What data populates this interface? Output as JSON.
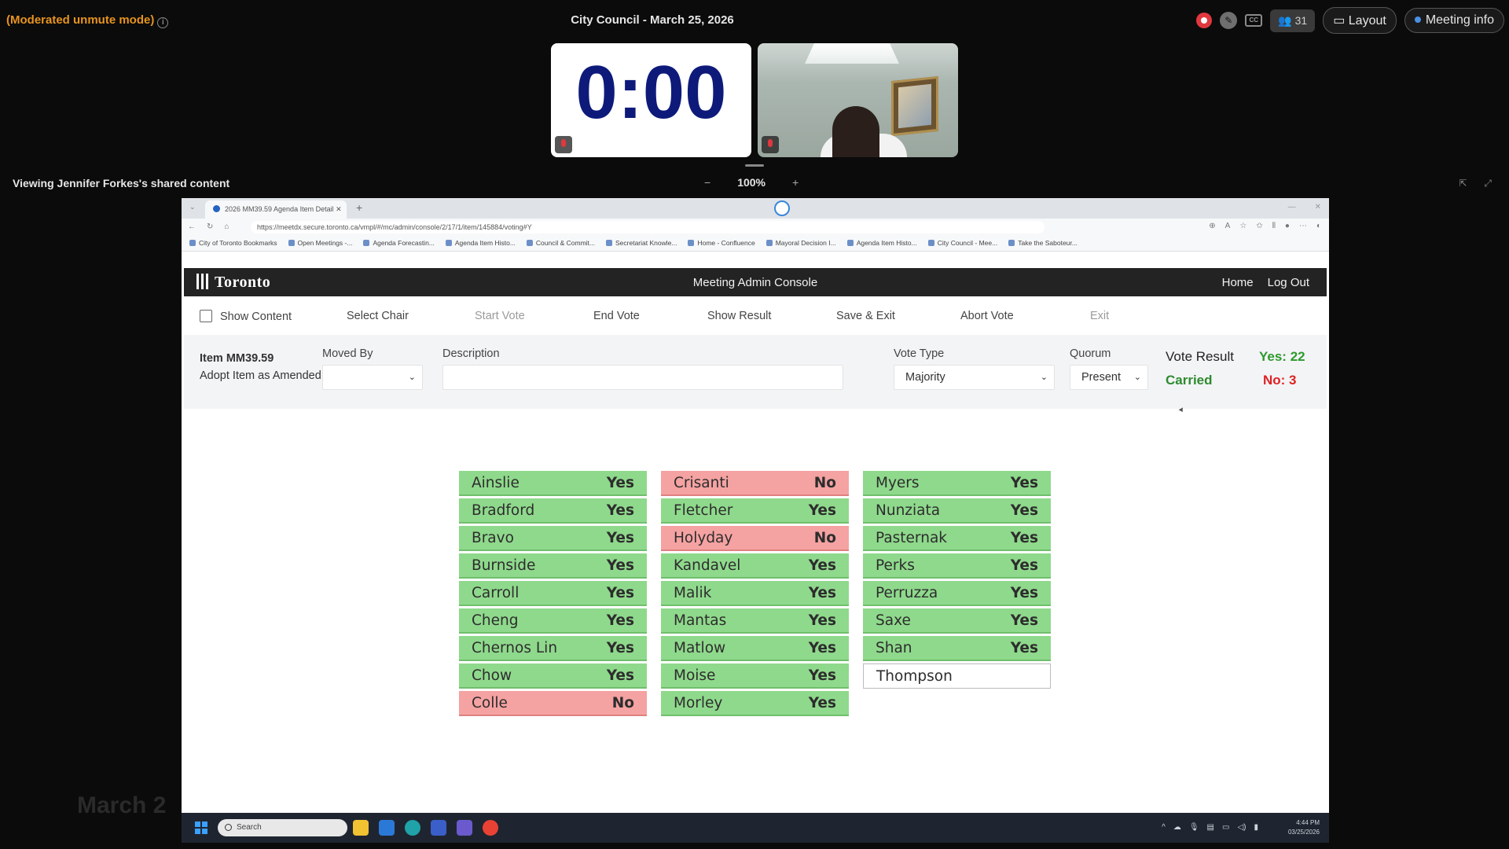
{
  "meeting": {
    "mode_text": "(Moderated unmute mode)",
    "title": "City Council - March 25, 2026",
    "participants_count": "31",
    "layout_label": "Layout",
    "meeting_info_label": "Meeting info",
    "timer": "0:00",
    "share_label": "Viewing Jennifer Forkes's shared content",
    "zoom_minus": "−",
    "zoom_value": "100%",
    "zoom_plus": "+"
  },
  "browser": {
    "tab_title": "2026 MM39.59 Agenda Item Detail",
    "tab_close": "✕",
    "new_tab": "+",
    "url": "https://meetdx.secure.toronto.ca/vmpl/#/mc/admin/console/2/17/1/item/145884/voting#Y",
    "bookmarks": [
      "City of Toronto Bookmarks",
      "Open Meetings -...",
      "Agenda Forecastin...",
      "Agenda Item Histo...",
      "Council & Commit...",
      "Secretariat Knowle...",
      "Home - Confluence",
      "Mayoral Decision I...",
      "Agenda Item Histo...",
      "City Council - Mee...",
      "Take the Saboteur..."
    ]
  },
  "app": {
    "logo_text": "Toronto",
    "title": "Meeting Admin Console",
    "links": {
      "home": "Home",
      "logout": "Log Out"
    },
    "toolbar": {
      "show_content": "Show Content",
      "select_chair": "Select Chair",
      "start_vote": "Start Vote",
      "end_vote": "End Vote",
      "show_result": "Show Result",
      "save_exit": "Save & Exit",
      "abort_vote": "Abort Vote",
      "exit": "Exit"
    },
    "item": {
      "id": "Item MM39.59",
      "description": "Adopt Item as Amended",
      "moved_by_label": "Moved By",
      "moved_by_value": "",
      "description_label": "Description",
      "description_value": "",
      "vote_type_label": "Vote Type",
      "vote_type_value": "Majority",
      "quorum_label": "Quorum",
      "quorum_value": "Present"
    },
    "result": {
      "label": "Vote Result",
      "outcome": "Carried",
      "yes": "Yes: 22",
      "no": "No: 3"
    },
    "votes": [
      [
        {
          "name": "Ainslie",
          "vote": "Yes"
        },
        {
          "name": "Bradford",
          "vote": "Yes"
        },
        {
          "name": "Bravo",
          "vote": "Yes"
        },
        {
          "name": "Burnside",
          "vote": "Yes"
        },
        {
          "name": "Carroll",
          "vote": "Yes"
        },
        {
          "name": "Cheng",
          "vote": "Yes"
        },
        {
          "name": "Chernos Lin",
          "vote": "Yes"
        },
        {
          "name": "Chow",
          "vote": "Yes"
        },
        {
          "name": "Colle",
          "vote": "No"
        }
      ],
      [
        {
          "name": "Crisanti",
          "vote": "No"
        },
        {
          "name": "Fletcher",
          "vote": "Yes"
        },
        {
          "name": "Holyday",
          "vote": "No"
        },
        {
          "name": "Kandavel",
          "vote": "Yes"
        },
        {
          "name": "Malik",
          "vote": "Yes"
        },
        {
          "name": "Mantas",
          "vote": "Yes"
        },
        {
          "name": "Matlow",
          "vote": "Yes"
        },
        {
          "name": "Moise",
          "vote": "Yes"
        },
        {
          "name": "Morley",
          "vote": "Yes"
        }
      ],
      [
        {
          "name": "Myers",
          "vote": "Yes"
        },
        {
          "name": "Nunziata",
          "vote": "Yes"
        },
        {
          "name": "Pasternak",
          "vote": "Yes"
        },
        {
          "name": "Perks",
          "vote": "Yes"
        },
        {
          "name": "Perruzza",
          "vote": "Yes"
        },
        {
          "name": "Saxe",
          "vote": "Yes"
        },
        {
          "name": "Shan",
          "vote": "Yes"
        },
        {
          "name": "Thompson",
          "vote": ""
        }
      ]
    ]
  },
  "overlay_text": "March 2",
  "taskbar": {
    "search_placeholder": "Search",
    "time": "4:44 PM",
    "date": "03/25/2026"
  },
  "colors": {
    "yes": "#8fd98c",
    "no": "#f5a2a2",
    "carried": "#2e8b2e",
    "no_count": "#dd2222",
    "timer": "#0e1a7a",
    "mode_text": "#e8941e"
  }
}
